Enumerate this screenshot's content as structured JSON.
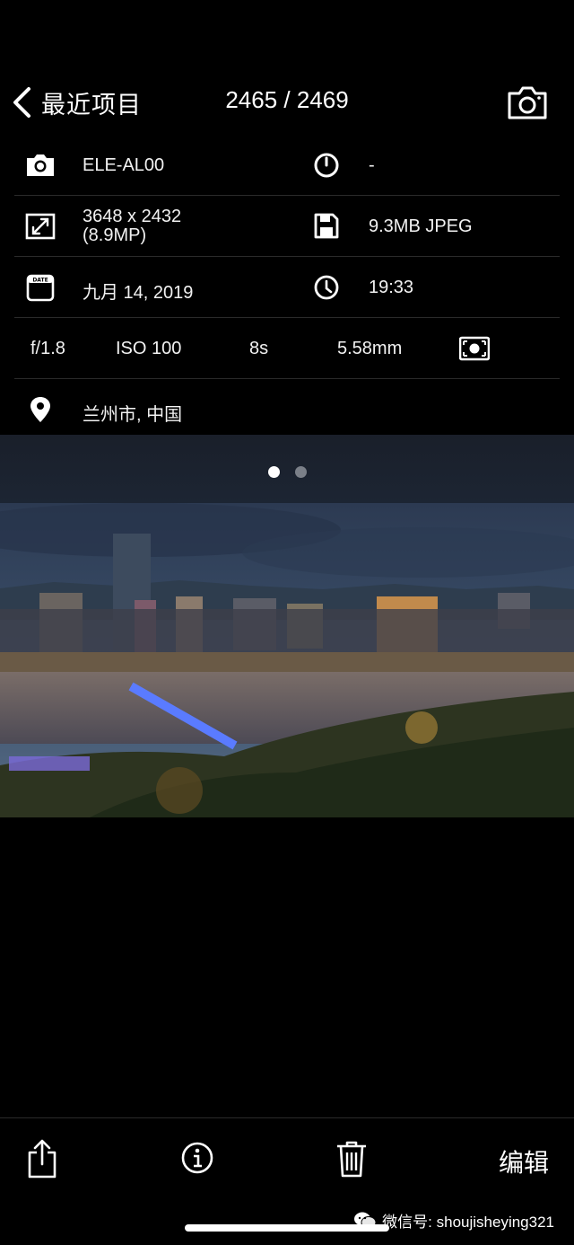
{
  "header": {
    "back_label": "最近项目",
    "counter": "2465 / 2469"
  },
  "info": {
    "camera_model": "ELE-AL00",
    "lens": "-",
    "dimensions_line1": "3648 x 2432",
    "dimensions_line2": "(8.9MP)",
    "file_info": "9.3MB JPEG",
    "date": "九月 14, 2019",
    "date_icon_label": "DATE",
    "time": "19:33",
    "aperture": "f/1.8",
    "iso": "ISO 100",
    "shutter": "8s",
    "focal_length": "5.58mm",
    "location": "兰州市, 中国"
  },
  "pager": {
    "total": 2,
    "active": 1
  },
  "toolbar": {
    "edit_label": "编辑"
  },
  "watermark": "微信号: shoujisheying321",
  "icons": [
    "chevron-left-icon",
    "camera-icon",
    "lens-icon",
    "expand-icon",
    "save-icon",
    "calendar-icon",
    "clock-icon",
    "metering-icon",
    "location-pin-icon",
    "share-icon",
    "info-icon",
    "trash-icon",
    "wechat-icon"
  ],
  "colors": {
    "background": "#000000",
    "divider": "#2a2a2a",
    "dot_active": "#ffffff",
    "dot_inactive": "#7a7f88"
  }
}
